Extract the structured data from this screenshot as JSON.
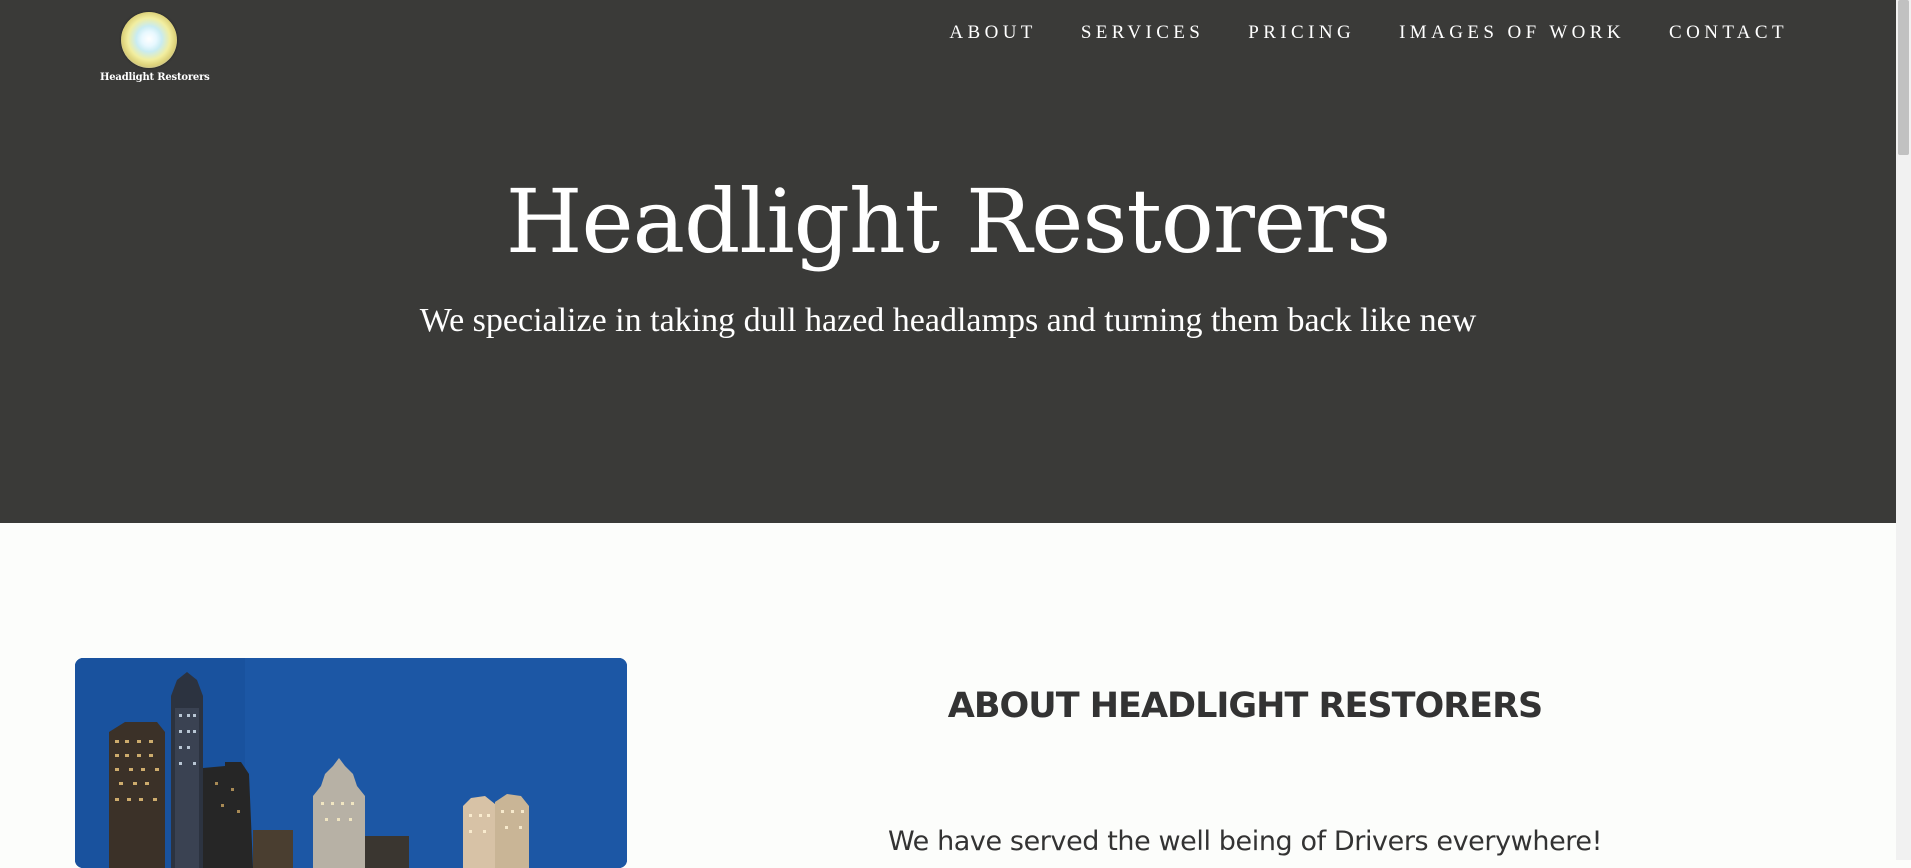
{
  "header": {
    "logo_text": "Headlight Restorers",
    "nav": [
      {
        "label": "ABOUT"
      },
      {
        "label": "SERVICES"
      },
      {
        "label": "PRICING"
      },
      {
        "label": "IMAGES OF WORK"
      },
      {
        "label": "CONTACT"
      }
    ]
  },
  "hero": {
    "title": "Headlight Restorers",
    "subtitle": "We specialize in taking dull hazed headlamps and turning them back like new"
  },
  "about": {
    "heading": "ABOUT HEADLIGHT RESTORERS",
    "text": "We have served the well being of Drivers everywhere!",
    "image_icon": "city-skyline-photo"
  },
  "colors": {
    "hero_bg": "#3a3a38",
    "page_bg": "#fcfdfb",
    "text_dark": "#333333",
    "sky_blue": "#1c57a5"
  }
}
